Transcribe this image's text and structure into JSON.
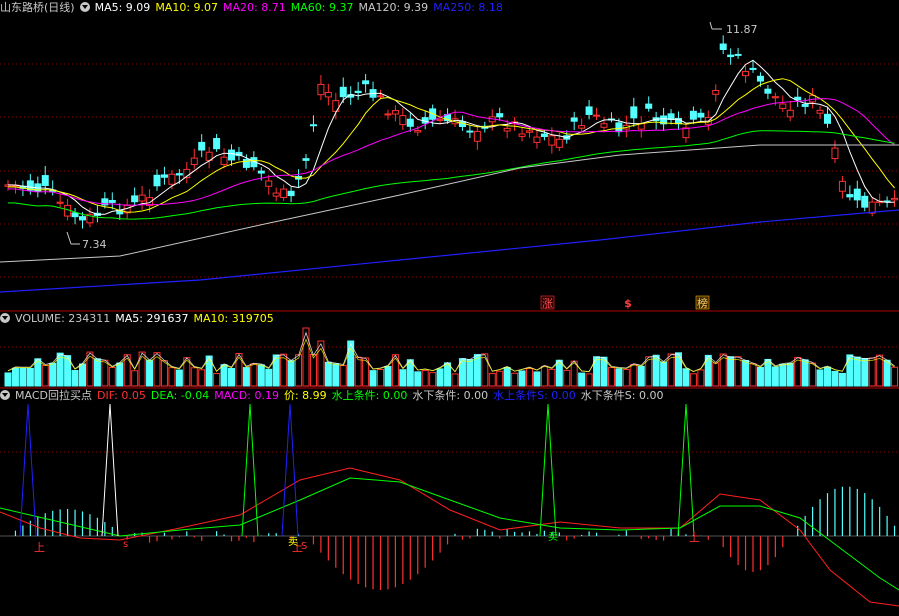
{
  "main_panel": {
    "title": "山东路桥(日线)",
    "indicators": [
      {
        "label": "MA5: 9.09",
        "color": "#ffffff"
      },
      {
        "label": "MA10: 9.07",
        "color": "#ffff00"
      },
      {
        "label": "MA20: 8.71",
        "color": "#ff00ff"
      },
      {
        "label": "MA60: 9.37",
        "color": "#00ff00"
      },
      {
        "label": "MA120: 9.39",
        "color": "#c8c8c8"
      },
      {
        "label": "MA250: 8.18",
        "color": "#2020ff"
      }
    ],
    "high_label": "11.87",
    "low_label": "7.34",
    "event_marks": [
      "涨",
      "$",
      "榜"
    ]
  },
  "volume_panel": {
    "indicators": [
      {
        "label": "VOLUME: 234311",
        "color": "#c8c8c8"
      },
      {
        "label": "MA5: 291637",
        "color": "#ffffff"
      },
      {
        "label": "MA10: 319705",
        "color": "#ffff00"
      }
    ]
  },
  "macd_panel": {
    "indicators": [
      {
        "label": "MACD回拉买点",
        "color": "#c8c8c8"
      },
      {
        "label": "DIF: 0.05",
        "color": "#ff3030"
      },
      {
        "label": "DEA: -0.04",
        "color": "#00ff00"
      },
      {
        "label": "MACD: 0.19",
        "color": "#ff00ff"
      },
      {
        "label": "价: 8.99",
        "color": "#ffff00"
      },
      {
        "label": "水上条件: 0.00",
        "color": "#00ff00"
      },
      {
        "label": "水下条件: 0.00",
        "color": "#c8c8c8"
      },
      {
        "label": "水上条件S: 0.00",
        "color": "#2020ff"
      },
      {
        "label": "水下条件S: 0.00",
        "color": "#c8c8c8"
      }
    ],
    "signal_marks": [
      "上",
      "s",
      "S",
      "卖"
    ]
  },
  "colors": {
    "up": "#ff3030",
    "down": "#54ffff",
    "divider": "#b00000",
    "grid": "#800000",
    "ma5": "#ffffff",
    "ma10": "#ffff00",
    "ma20": "#ff00ff",
    "ma60": "#00ff00",
    "ma120": "#c8c8c8",
    "ma250": "#2020ff"
  }
}
